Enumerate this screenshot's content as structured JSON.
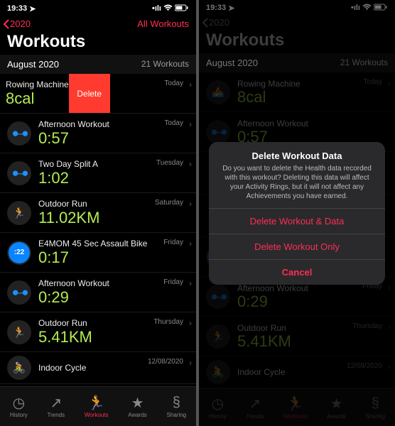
{
  "status": {
    "time": "19:33",
    "loc_icon": "location-arrow"
  },
  "nav": {
    "back": "2020",
    "link": "All Workouts"
  },
  "title": "Workouts",
  "section": {
    "month": "August 2020",
    "count": "21 Workouts"
  },
  "delete_label": "Delete",
  "workouts": [
    {
      "name": "Rowing Machine",
      "metric": "8cal",
      "day": "Today",
      "icon": "rowing"
    },
    {
      "name": "Afternoon Workout",
      "metric": "0:57",
      "day": "Today",
      "icon": "dumbbell"
    },
    {
      "name": "Two Day Split A",
      "metric": "1:02",
      "day": "Tuesday",
      "icon": "dumbbell"
    },
    {
      "name": "Outdoor Run",
      "metric": "11.02KM",
      "day": "Saturday",
      "icon": "run"
    },
    {
      "name": "E4MOM 45 Sec Assault Bike",
      "metric": "0:17",
      "day": "Friday",
      "icon": "timer22"
    },
    {
      "name": "Afternoon Workout",
      "metric": "0:29",
      "day": "Friday",
      "icon": "dumbbell"
    },
    {
      "name": "Outdoor Run",
      "metric": "5.41KM",
      "day": "Thursday",
      "icon": "run"
    },
    {
      "name": "Indoor Cycle",
      "metric": "",
      "day": "12/08/2020",
      "icon": "cycle"
    }
  ],
  "tabs": [
    {
      "label": "History",
      "active": false
    },
    {
      "label": "Trends",
      "active": false
    },
    {
      "label": "Workouts",
      "active": true
    },
    {
      "label": "Awards",
      "active": false
    },
    {
      "label": "Sharing",
      "active": false
    }
  ],
  "alert": {
    "title": "Delete Workout Data",
    "message": "Do you want to delete the Health data recorded with this workout? Deleting this data will affect your Activity Rings, but it will not affect any Achievements you have earned.",
    "btn1": "Delete Workout & Data",
    "btn2": "Delete Workout Only",
    "btn3": "Cancel"
  }
}
